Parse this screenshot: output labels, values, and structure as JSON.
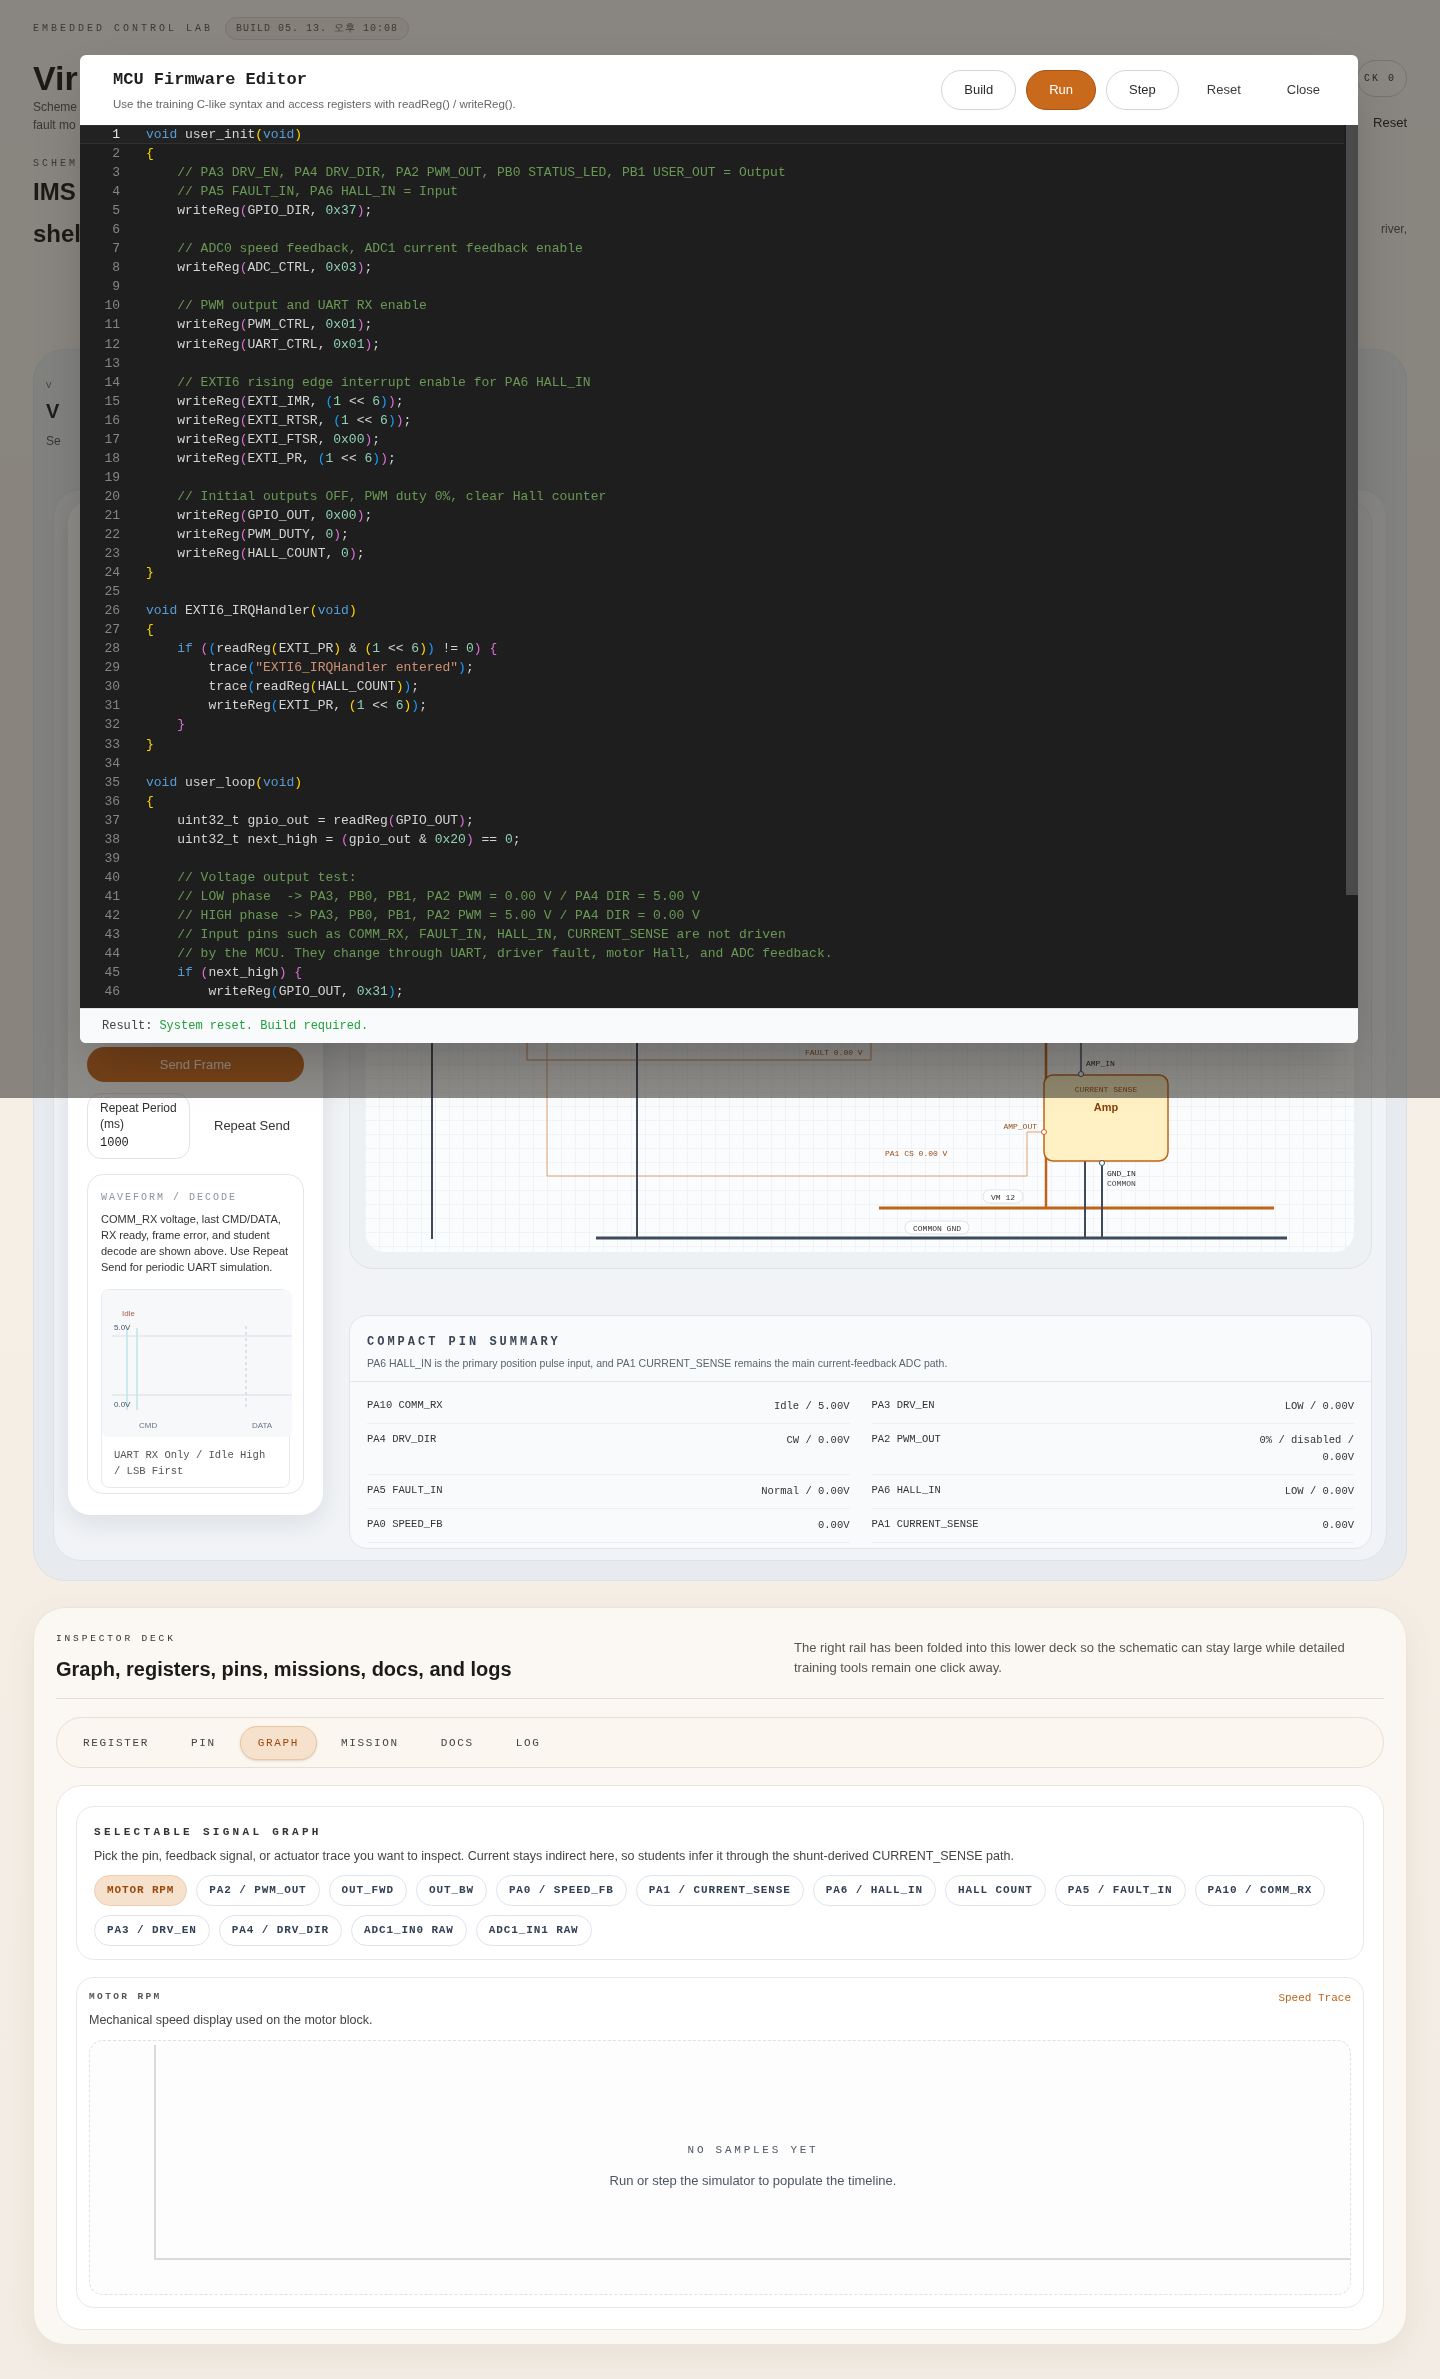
{
  "backdrop": {
    "eyebrow": "EMBEDDED CONTROL LAB",
    "build": "BUILD 05. 13. 오후 10:08",
    "title": "Vir",
    "intro": [
      "Scheme",
      "fault mo"
    ],
    "tick": "CK 0",
    "reset": "Reset",
    "section_label": "SCHEM",
    "section_title": [
      "IMS",
      "shel"
    ],
    "section_note": "river,",
    "panel_label": "V",
    "panel_title": "V",
    "panel_note": "Se"
  },
  "editor": {
    "title": "MCU Firmware Editor",
    "subtitle": "Use the training C-like syntax and access registers with readReg() / writeReg().",
    "buttons": [
      {
        "label": "Build",
        "kind": "outline"
      },
      {
        "label": "Run",
        "kind": "primary"
      },
      {
        "label": "Step",
        "kind": "outline"
      },
      {
        "label": "Reset",
        "kind": "ghost"
      },
      {
        "label": "Close",
        "kind": "ghost"
      }
    ],
    "lines": [
      {
        "number": "1",
        "current": true,
        "tokens": [
          {
            "kind": "keyword",
            "text": "void"
          },
          {
            "kind": "plain",
            "text": " user_init"
          },
          {
            "kind": "b1",
            "text": "("
          },
          {
            "kind": "keyword",
            "text": "void"
          },
          {
            "kind": "b1",
            "text": ")"
          }
        ]
      },
      {
        "number": "2",
        "current": false,
        "tokens": [
          {
            "kind": "b1",
            "text": "{"
          }
        ]
      },
      {
        "number": "3",
        "current": false,
        "tokens": [
          {
            "kind": "comment",
            "text": "    // PA3 DRV_EN, PA4 DRV_DIR, PA2 PWM_OUT, PB0 STATUS_LED, PB1 USER_OUT = Output"
          }
        ]
      },
      {
        "number": "4",
        "current": false,
        "tokens": [
          {
            "kind": "comment",
            "text": "    // PA5 FAULT_IN, PA6 HALL_IN = Input"
          }
        ]
      },
      {
        "number": "5",
        "current": false,
        "tokens": [
          {
            "kind": "plain",
            "text": "    writeReg"
          },
          {
            "kind": "b2",
            "text": "("
          },
          {
            "kind": "plain",
            "text": "GPIO_DIR, "
          },
          {
            "kind": "number",
            "text": "0x37"
          },
          {
            "kind": "b2",
            "text": ")"
          },
          {
            "kind": "plain",
            "text": ";"
          }
        ]
      },
      {
        "number": "6",
        "current": false
      },
      {
        "number": "7",
        "current": false,
        "tokens": [
          {
            "kind": "comment",
            "text": "    // ADC0 speed feedback, ADC1 current feedback enable"
          }
        ]
      },
      {
        "number": "8",
        "current": false,
        "tokens": [
          {
            "kind": "plain",
            "text": "    writeReg"
          },
          {
            "kind": "b2",
            "text": "("
          },
          {
            "kind": "plain",
            "text": "ADC_CTRL, "
          },
          {
            "kind": "number",
            "text": "0x03"
          },
          {
            "kind": "b2",
            "text": ")"
          },
          {
            "kind": "plain",
            "text": ";"
          }
        ]
      },
      {
        "number": "9",
        "current": false
      },
      {
        "number": "10",
        "current": false,
        "tokens": [
          {
            "kind": "comment",
            "text": "    // PWM output and UART RX enable"
          }
        ]
      },
      {
        "number": "11",
        "current": false,
        "tokens": [
          {
            "kind": "plain",
            "text": "    writeReg"
          },
          {
            "kind": "b2",
            "text": "("
          },
          {
            "kind": "plain",
            "text": "PWM_CTRL, "
          },
          {
            "kind": "number",
            "text": "0x01"
          },
          {
            "kind": "b2",
            "text": ")"
          },
          {
            "kind": "plain",
            "text": ";"
          }
        ]
      },
      {
        "number": "12",
        "current": false,
        "tokens": [
          {
            "kind": "plain",
            "text": "    writeReg"
          },
          {
            "kind": "b2",
            "text": "("
          },
          {
            "kind": "plain",
            "text": "UART_CTRL, "
          },
          {
            "kind": "number",
            "text": "0x01"
          },
          {
            "kind": "b2",
            "text": ")"
          },
          {
            "kind": "plain",
            "text": ";"
          }
        ]
      },
      {
        "number": "13",
        "current": false
      },
      {
        "number": "14",
        "current": false,
        "tokens": [
          {
            "kind": "comment",
            "text": "    // EXTI6 rising edge interrupt enable for PA6 HALL_IN"
          }
        ]
      },
      {
        "number": "15",
        "current": false,
        "tokens": [
          {
            "kind": "plain",
            "text": "    writeReg"
          },
          {
            "kind": "b2",
            "text": "("
          },
          {
            "kind": "plain",
            "text": "EXTI_IMR, "
          },
          {
            "kind": "b3",
            "text": "("
          },
          {
            "kind": "number",
            "text": "1"
          },
          {
            "kind": "plain",
            "text": " << "
          },
          {
            "kind": "number",
            "text": "6"
          },
          {
            "kind": "b3",
            "text": ")"
          },
          {
            "kind": "b2",
            "text": ")"
          },
          {
            "kind": "plain",
            "text": ";"
          }
        ]
      },
      {
        "number": "16",
        "current": false,
        "tokens": [
          {
            "kind": "plain",
            "text": "    writeReg"
          },
          {
            "kind": "b2",
            "text": "("
          },
          {
            "kind": "plain",
            "text": "EXTI_RTSR, "
          },
          {
            "kind": "b3",
            "text": "("
          },
          {
            "kind": "number",
            "text": "1"
          },
          {
            "kind": "plain",
            "text": " << "
          },
          {
            "kind": "number",
            "text": "6"
          },
          {
            "kind": "b3",
            "text": ")"
          },
          {
            "kind": "b2",
            "text": ")"
          },
          {
            "kind": "plain",
            "text": ";"
          }
        ]
      },
      {
        "number": "17",
        "current": false,
        "tokens": [
          {
            "kind": "plain",
            "text": "    writeReg"
          },
          {
            "kind": "b2",
            "text": "("
          },
          {
            "kind": "plain",
            "text": "EXTI_FTSR, "
          },
          {
            "kind": "number",
            "text": "0x00"
          },
          {
            "kind": "b2",
            "text": ")"
          },
          {
            "kind": "plain",
            "text": ";"
          }
        ]
      },
      {
        "number": "18",
        "current": false,
        "tokens": [
          {
            "kind": "plain",
            "text": "    writeReg"
          },
          {
            "kind": "b2",
            "text": "("
          },
          {
            "kind": "plain",
            "text": "EXTI_PR, "
          },
          {
            "kind": "b3",
            "text": "("
          },
          {
            "kind": "number",
            "text": "1"
          },
          {
            "kind": "plain",
            "text": " << "
          },
          {
            "kind": "number",
            "text": "6"
          },
          {
            "kind": "b3",
            "text": ")"
          },
          {
            "kind": "b2",
            "text": ")"
          },
          {
            "kind": "plain",
            "text": ";"
          }
        ]
      },
      {
        "number": "19",
        "current": false
      },
      {
        "number": "20",
        "current": false,
        "tokens": [
          {
            "kind": "comment",
            "text": "    // Initial outputs OFF, PWM duty 0%, clear Hall counter"
          }
        ]
      },
      {
        "number": "21",
        "current": false,
        "tokens": [
          {
            "kind": "plain",
            "text": "    writeReg"
          },
          {
            "kind": "b2",
            "text": "("
          },
          {
            "kind": "plain",
            "text": "GPIO_OUT, "
          },
          {
            "kind": "number",
            "text": "0x00"
          },
          {
            "kind": "b2",
            "text": ")"
          },
          {
            "kind": "plain",
            "text": ";"
          }
        ]
      },
      {
        "number": "22",
        "current": false,
        "tokens": [
          {
            "kind": "plain",
            "text": "    writeReg"
          },
          {
            "kind": "b2",
            "text": "("
          },
          {
            "kind": "plain",
            "text": "PWM_DUTY, "
          },
          {
            "kind": "number",
            "text": "0"
          },
          {
            "kind": "b2",
            "text": ")"
          },
          {
            "kind": "plain",
            "text": ";"
          }
        ]
      },
      {
        "number": "23",
        "current": false,
        "tokens": [
          {
            "kind": "plain",
            "text": "    writeReg"
          },
          {
            "kind": "b2",
            "text": "("
          },
          {
            "kind": "plain",
            "text": "HALL_COUNT, "
          },
          {
            "kind": "number",
            "text": "0"
          },
          {
            "kind": "b2",
            "text": ")"
          },
          {
            "kind": "plain",
            "text": ";"
          }
        ]
      },
      {
        "number": "24",
        "current": false,
        "tokens": [
          {
            "kind": "b1",
            "text": "}"
          }
        ]
      },
      {
        "number": "25",
        "current": false
      },
      {
        "number": "26",
        "current": false,
        "tokens": [
          {
            "kind": "keyword",
            "text": "void"
          },
          {
            "kind": "plain",
            "text": " EXTI6_IRQHandler"
          },
          {
            "kind": "b1",
            "text": "("
          },
          {
            "kind": "keyword",
            "text": "void"
          },
          {
            "kind": "b1",
            "text": ")"
          }
        ]
      },
      {
        "number": "27",
        "current": false,
        "tokens": [
          {
            "kind": "b1",
            "text": "{"
          }
        ]
      },
      {
        "number": "28",
        "current": false,
        "tokens": [
          {
            "kind": "keyword",
            "text": "    if"
          },
          {
            "kind": "b2",
            "text": " ("
          },
          {
            "kind": "b3",
            "text": "("
          },
          {
            "kind": "plain",
            "text": "readReg"
          },
          {
            "kind": "b1",
            "text": "("
          },
          {
            "kind": "plain",
            "text": "EXTI_PR"
          },
          {
            "kind": "b1",
            "text": ")"
          },
          {
            "kind": "plain",
            "text": " & "
          },
          {
            "kind": "b1",
            "text": "("
          },
          {
            "kind": "number",
            "text": "1"
          },
          {
            "kind": "plain",
            "text": " << "
          },
          {
            "kind": "number",
            "text": "6"
          },
          {
            "kind": "b1",
            "text": ")"
          },
          {
            "kind": "b3",
            "text": ")"
          },
          {
            "kind": "plain",
            "text": " != "
          },
          {
            "kind": "number",
            "text": "0"
          },
          {
            "kind": "b2",
            "text": ")"
          },
          {
            "kind": "b2",
            "text": " {"
          }
        ]
      },
      {
        "number": "29",
        "current": false,
        "tokens": [
          {
            "kind": "plain",
            "text": "        trace"
          },
          {
            "kind": "b3",
            "text": "("
          },
          {
            "kind": "string",
            "text": "\"EXTI6_IRQHandler entered\""
          },
          {
            "kind": "b3",
            "text": ")"
          },
          {
            "kind": "plain",
            "text": ";"
          }
        ]
      },
      {
        "number": "30",
        "current": false,
        "tokens": [
          {
            "kind": "plain",
            "text": "        trace"
          },
          {
            "kind": "b3",
            "text": "("
          },
          {
            "kind": "plain",
            "text": "readReg"
          },
          {
            "kind": "b1",
            "text": "("
          },
          {
            "kind": "plain",
            "text": "HALL_COUNT"
          },
          {
            "kind": "b1",
            "text": ")"
          },
          {
            "kind": "b3",
            "text": ")"
          },
          {
            "kind": "plain",
            "text": ";"
          }
        ]
      },
      {
        "number": "31",
        "current": false,
        "tokens": [
          {
            "kind": "plain",
            "text": "        writeReg"
          },
          {
            "kind": "b3",
            "text": "("
          },
          {
            "kind": "plain",
            "text": "EXTI_PR, "
          },
          {
            "kind": "b1",
            "text": "("
          },
          {
            "kind": "number",
            "text": "1"
          },
          {
            "kind": "plain",
            "text": " << "
          },
          {
            "kind": "number",
            "text": "6"
          },
          {
            "kind": "b1",
            "text": ")"
          },
          {
            "kind": "b3",
            "text": ")"
          },
          {
            "kind": "plain",
            "text": ";"
          }
        ]
      },
      {
        "number": "32",
        "current": false,
        "tokens": [
          {
            "kind": "b2",
            "text": "    }"
          }
        ]
      },
      {
        "number": "33",
        "current": false,
        "tokens": [
          {
            "kind": "b1",
            "text": "}"
          }
        ]
      },
      {
        "number": "34",
        "current": false
      },
      {
        "number": "35",
        "current": false,
        "tokens": [
          {
            "kind": "keyword",
            "text": "void"
          },
          {
            "kind": "plain",
            "text": " user_loop"
          },
          {
            "kind": "b1",
            "text": "("
          },
          {
            "kind": "keyword",
            "text": "void"
          },
          {
            "kind": "b1",
            "text": ")"
          }
        ]
      },
      {
        "number": "36",
        "current": false,
        "tokens": [
          {
            "kind": "b1",
            "text": "{"
          }
        ]
      },
      {
        "number": "37",
        "current": false,
        "tokens": [
          {
            "kind": "plain",
            "text": "    uint32_t gpio_out = readReg"
          },
          {
            "kind": "b2",
            "text": "("
          },
          {
            "kind": "plain",
            "text": "GPIO_OUT"
          },
          {
            "kind": "b2",
            "text": ")"
          },
          {
            "kind": "plain",
            "text": ";"
          }
        ]
      },
      {
        "number": "38",
        "current": false,
        "tokens": [
          {
            "kind": "plain",
            "text": "    uint32_t next_high = "
          },
          {
            "kind": "b2",
            "text": "("
          },
          {
            "kind": "plain",
            "text": "gpio_out & "
          },
          {
            "kind": "number",
            "text": "0x20"
          },
          {
            "kind": "b2",
            "text": ")"
          },
          {
            "kind": "plain",
            "text": " == "
          },
          {
            "kind": "number",
            "text": "0"
          },
          {
            "kind": "plain",
            "text": ";"
          }
        ]
      },
      {
        "number": "39",
        "current": false
      },
      {
        "number": "40",
        "current": false,
        "tokens": [
          {
            "kind": "comment",
            "text": "    // Voltage output test:"
          }
        ]
      },
      {
        "number": "41",
        "current": false,
        "tokens": [
          {
            "kind": "comment",
            "text": "    // LOW phase  -> PA3, PB0, PB1, PA2 PWM = 0.00 V / PA4 DIR = 5.00 V"
          }
        ]
      },
      {
        "number": "42",
        "current": false,
        "tokens": [
          {
            "kind": "comment",
            "text": "    // HIGH phase -> PA3, PB0, PB1, PA2 PWM = 5.00 V / PA4 DIR = 0.00 V"
          }
        ]
      },
      {
        "number": "43",
        "current": false,
        "tokens": [
          {
            "kind": "comment",
            "text": "    // Input pins such as COMM_RX, FAULT_IN, HALL_IN, CURRENT_SENSE are not driven"
          }
        ]
      },
      {
        "number": "44",
        "current": false,
        "tokens": [
          {
            "kind": "comment",
            "text": "    // by the MCU. They change through UART, driver fault, motor Hall, and ADC feedback."
          }
        ]
      },
      {
        "number": "45",
        "current": false,
        "tokens": [
          {
            "kind": "keyword",
            "text": "    if"
          },
          {
            "kind": "b2",
            "text": " ("
          },
          {
            "kind": "plain",
            "text": "next_high"
          },
          {
            "kind": "b2",
            "text": ")"
          },
          {
            "kind": "b2",
            "text": " {"
          }
        ]
      },
      {
        "number": "46",
        "current": false,
        "tokens": [
          {
            "kind": "plain",
            "text": "        writeReg"
          },
          {
            "kind": "b3",
            "text": "("
          },
          {
            "kind": "plain",
            "text": "GPIO_OUT, "
          },
          {
            "kind": "number",
            "text": "0x31"
          },
          {
            "kind": "b3",
            "text": ")"
          },
          {
            "kind": "plain",
            "text": ";"
          }
        ]
      }
    ],
    "result_label": "Result:",
    "result": "System reset. Build required."
  },
  "uart": {
    "send": "Send Frame",
    "repeat_period": {
      "label": "Repeat Period (ms)",
      "value": "1000"
    },
    "repeat_send": "Repeat Send",
    "waveform": {
      "title": "WAVEFORM / DECODE",
      "text": "COMM_RX voltage, last CMD/DATA, RX ready, frame error, and student decode are shown above. Use Repeat Send for periodic UART simulation.",
      "state": "Idle",
      "high": "5.0V",
      "low": "0.0V",
      "fields": [
        "CMD",
        "DATA"
      ],
      "caption": "UART RX Only / Idle High / LSB First"
    }
  },
  "schematic": {
    "fault": "FAULT 0.00 V",
    "current_sense": "PA1 CS 0.00 V",
    "amp": {
      "tag": "CURRENT SENSE",
      "name": "Amp",
      "input": "AMP_IN",
      "output": "AMP_OUT",
      "ground": "GND_IN",
      "ground_note": "COMMON"
    },
    "rails": [
      "VM 12",
      "COMMON GND"
    ]
  },
  "pin_summary": {
    "title": "COMPACT PIN SUMMARY",
    "subtitle": "PA6 HALL_IN is the primary position pulse input, and PA1 CURRENT_SENSE remains the main current-feedback ADC path.",
    "pins": [
      {
        "pin": "PA10 COMM_RX",
        "value": "Idle / 5.00V"
      },
      {
        "pin": "PA3 DRV_EN",
        "value": "LOW / 0.00V"
      },
      {
        "pin": "PA4 DRV_DIR",
        "value": "CW / 0.00V"
      },
      {
        "pin": "PA2 PWM_OUT",
        "value": "0% / disabled / 0.00V"
      },
      {
        "pin": "PA5 FAULT_IN",
        "value": "Normal / 0.00V"
      },
      {
        "pin": "PA6 HALL_IN",
        "value": "LOW / 0.00V"
      },
      {
        "pin": "PA0 SPEED_FB",
        "value": "0.00V"
      },
      {
        "pin": "PA1 CURRENT_SENSE",
        "value": "0.00V"
      }
    ]
  },
  "inspector": {
    "eyebrow": "INSPECTOR DECK",
    "title": "Graph, registers, pins, missions, docs, and logs",
    "note": "The right rail has been folded into this lower deck so the schematic can stay large while detailed training tools remain one click away.",
    "tabs": [
      {
        "label": "REGISTER",
        "selected": false
      },
      {
        "label": "PIN",
        "selected": false
      },
      {
        "label": "GRAPH",
        "selected": true
      },
      {
        "label": "MISSION",
        "selected": false
      },
      {
        "label": "DOCS",
        "selected": false
      },
      {
        "label": "LOG",
        "selected": false
      }
    ],
    "signal_picker": {
      "title": "SELECTABLE SIGNAL GRAPH",
      "text": "Pick the pin, feedback signal, or actuator trace you want to inspect. Current stays indirect here, so students infer it through the shunt-derived CURRENT_SENSE path.",
      "signals": [
        {
          "label": "MOTOR RPM",
          "selected": true
        },
        {
          "label": "PA2 / PWM_OUT",
          "selected": false
        },
        {
          "label": "OUT_FWD",
          "selected": false
        },
        {
          "label": "OUT_BW",
          "selected": false
        },
        {
          "label": "PA0 / SPEED_FB",
          "selected": false
        },
        {
          "label": "PA1 / CURRENT_SENSE",
          "selected": false
        },
        {
          "label": "PA6 / HALL_IN",
          "selected": false
        },
        {
          "label": "HALL COUNT",
          "selected": false
        },
        {
          "label": "PA5 / FAULT_IN",
          "selected": false
        },
        {
          "label": "PA10 / COMM_RX",
          "selected": false
        },
        {
          "label": "PA3 / DRV_EN",
          "selected": false
        },
        {
          "label": "PA4 / DRV_DIR",
          "selected": false
        },
        {
          "label": "ADC1_IN0 RAW",
          "selected": false
        },
        {
          "label": "ADC1_IN1 RAW",
          "selected": false
        }
      ]
    },
    "graph": {
      "title": "MOTOR RPM",
      "tag": "Speed Trace",
      "text": "Mechanical speed display used on the motor block.",
      "empty_title": "NO SAMPLES YET",
      "empty_text": "Run or step the simulator to populate the timeline."
    }
  }
}
